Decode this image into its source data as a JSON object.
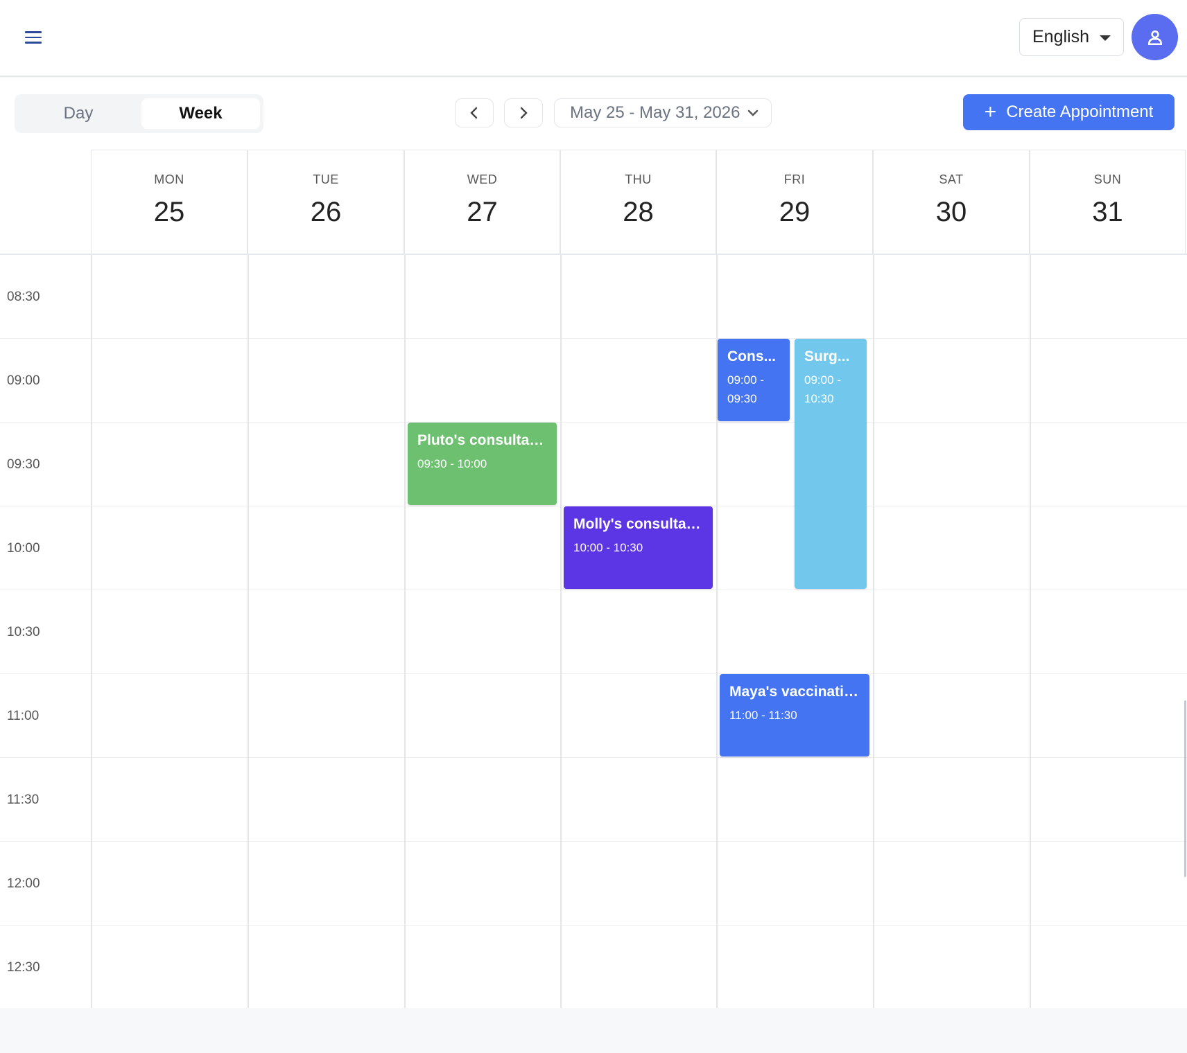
{
  "header": {
    "language": "English",
    "icons": {
      "menu": "hamburger-icon",
      "user": "user-icon"
    }
  },
  "toolbar": {
    "view_day": "Day",
    "view_week": "Week",
    "selected_view": "Week",
    "date_range": "May 25 - May 31, 2026",
    "create_label": "Create Appointment",
    "accent": "#4474f2"
  },
  "days": [
    {
      "dow": "MON",
      "num": "25"
    },
    {
      "dow": "TUE",
      "num": "26"
    },
    {
      "dow": "WED",
      "num": "27"
    },
    {
      "dow": "THU",
      "num": "28"
    },
    {
      "dow": "FRI",
      "num": "29"
    },
    {
      "dow": "SAT",
      "num": "30"
    },
    {
      "dow": "SUN",
      "num": "31"
    }
  ],
  "time_labels": [
    "08:30",
    "09:00",
    "09:30",
    "10:00",
    "10:30",
    "11:00",
    "11:30",
    "12:00",
    "12:30"
  ],
  "events": [
    {
      "title": "Pluto's consultati...",
      "time": "09:30 - 10:00",
      "color": "#6cc070"
    },
    {
      "title": "Molly's consultat...",
      "time": "10:00 - 10:30",
      "color": "#5c35e4"
    },
    {
      "title": "Cons...",
      "time_line1": "09:00 -",
      "time_line2": "09:30",
      "color": "#4474f2"
    },
    {
      "title": "Surg...",
      "time_line1": "09:00 -",
      "time_line2": "10:30",
      "color": "#72c8ec"
    },
    {
      "title": "Maya's vaccination",
      "time": "11:00 - 11:30",
      "color": "#4474f2"
    }
  ]
}
